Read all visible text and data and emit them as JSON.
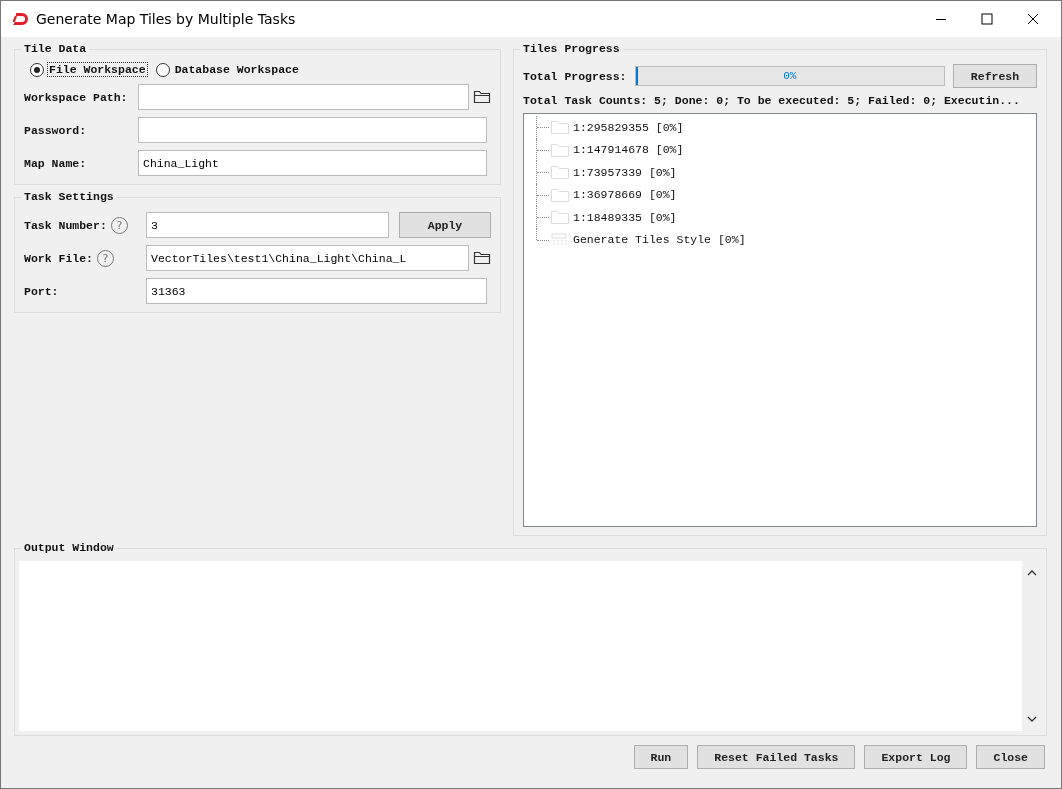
{
  "window": {
    "title": "Generate Map Tiles by Multiple Tasks"
  },
  "tile_data": {
    "title": "Tile Data",
    "workspace_options": [
      {
        "label": "File Workspace",
        "selected": true,
        "focused": true
      },
      {
        "label": "Database Workspace",
        "selected": false,
        "focused": false
      }
    ],
    "fields": [
      {
        "label": "Workspace Path:",
        "browse": true
      },
      {
        "label": "Password:",
        "browse": false
      },
      {
        "label": "Map Name:",
        "value": "China_Light",
        "browse": false
      }
    ]
  },
  "task_settings": {
    "title": "Task Settings",
    "fields": [
      {
        "label": "Task Number:",
        "help": "?",
        "value": "3",
        "browse": false,
        "action": "Apply"
      },
      {
        "label": "Work File:",
        "help": "?",
        "value": "VectorTiles\\test1\\China_Light\\China_L",
        "browse": true
      },
      {
        "label": "Port:",
        "value": "31363",
        "browse": false
      }
    ]
  },
  "tiles_progress": {
    "title": "Tiles Progress",
    "progress_label": "Total Progress:",
    "level": 0,
    "reading": "0%",
    "refresh": "Refresh",
    "summary": "Total Task Counts: 5; Done: 0; To be executed: 5; Failed: 0; Executin...",
    "tree": [
      {
        "kind": "folder",
        "label": "1:295829355 [0%]"
      },
      {
        "kind": "folder",
        "label": "1:147914678 [0%]"
      },
      {
        "kind": "folder",
        "label": "1:73957339 [0%]"
      },
      {
        "kind": "folder",
        "label": "1:36978669 [0%]"
      },
      {
        "kind": "folder",
        "label": "1:18489335 [0%]"
      },
      {
        "kind": "style",
        "label": "Generate Tiles Style [0%]"
      }
    ]
  },
  "output_window": {
    "title": "Output Window"
  },
  "buttons": [
    "Run",
    "Reset Failed Tasks",
    "Export Log",
    "Close"
  ]
}
